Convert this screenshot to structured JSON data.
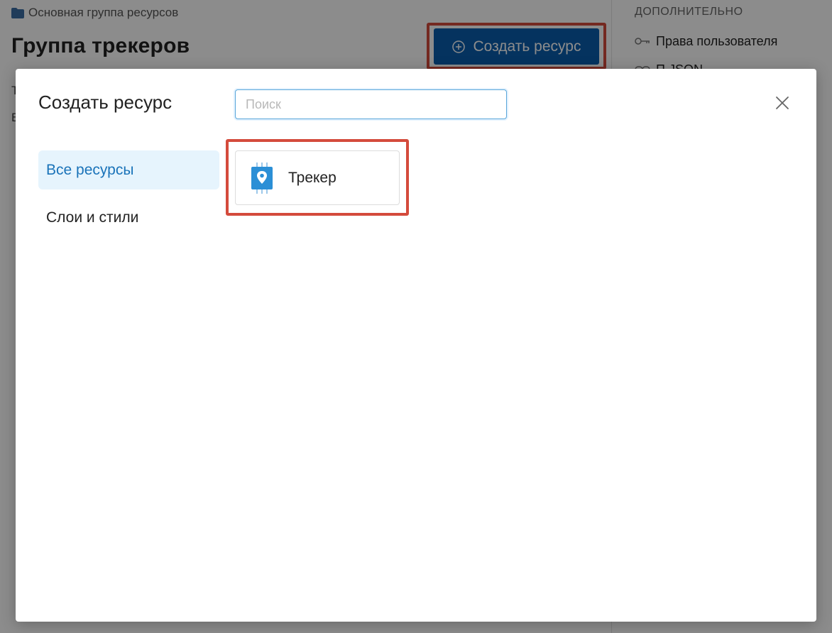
{
  "background": {
    "breadcrumb": "Основная группа ресурсов",
    "page_title": "Группа трекеров",
    "text_line_1": "Т",
    "text_line_2": "В",
    "create_button_label": "Создать ресурс",
    "right_panel": {
      "heading": "ДОПОЛНИТЕЛЬНО",
      "items": [
        {
          "label": "Права пользователя",
          "icon": "key-icon"
        },
        {
          "label": "П                    JSON",
          "icon": "link-icon"
        }
      ]
    }
  },
  "modal": {
    "title": "Создать ресурс",
    "search": {
      "placeholder": "Поиск",
      "value": ""
    },
    "categories": [
      {
        "label": "Все ресурсы",
        "active": true
      },
      {
        "label": "Слои и стили",
        "active": false
      }
    ],
    "resources": [
      {
        "label": "Трекер",
        "icon": "tracker-icon"
      }
    ]
  },
  "colors": {
    "primary": "#0a5eae",
    "highlight_border": "#d44b3c",
    "active_category_bg": "#e6f4fd",
    "active_category_text": "#1a73b9",
    "tracker_icon": "#2b8fd6"
  }
}
